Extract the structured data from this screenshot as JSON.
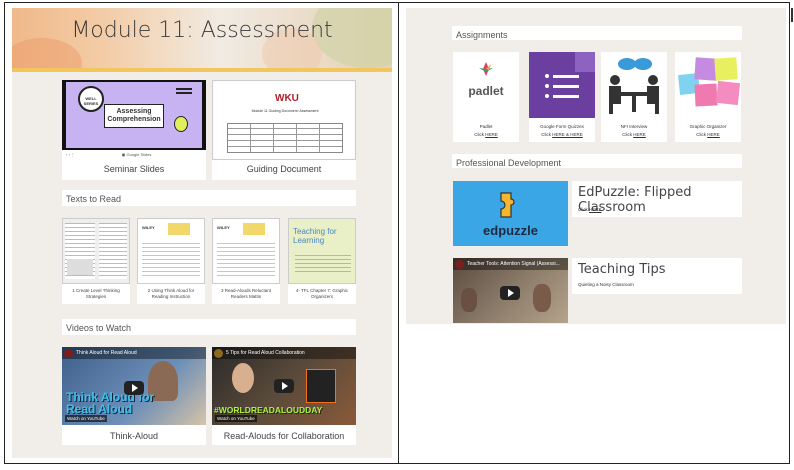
{
  "banner": {
    "title": "Module 11: Assessment"
  },
  "top_cards": [
    {
      "caption": "Seminar Slides",
      "thumb_title": "Assessing Comprehension",
      "badge": "WELL SERIES"
    },
    {
      "caption": "Guiding Document",
      "thumb_title": "Module 11 Guiding Document: Assessment",
      "logo": "WKU"
    }
  ],
  "texts_section": {
    "label": "Texts to Read"
  },
  "texts": [
    {
      "caption": "1 Create Level Thinking Strategies"
    },
    {
      "caption": "2 Using Think Aloud for Reading Instruction"
    },
    {
      "caption": "3 Read-Alouds Reluctant Readers Mattin"
    },
    {
      "caption": "4- TFL Chapter 7: Graphic Organizers",
      "thumb_title": "Teaching for Learning"
    }
  ],
  "videos_section": {
    "label": "Videos to Watch"
  },
  "videos": [
    {
      "caption": "Think-Aloud",
      "video_title": "Think Aloud for Read Aloud",
      "overlay": "Think Aloud for Read Aloud",
      "watch": "Watch on YouTube"
    },
    {
      "caption": "Read-Alouds for Collaboration",
      "video_title": "5 Tips for Read Aloud Collaboration",
      "overlay": "#WORLDREADALOUDDAY",
      "watch": "Watch on YouTube"
    }
  ],
  "assignments_section": {
    "label": "Assignments"
  },
  "assignments": [
    {
      "caption": "Padlet",
      "link_prefix": "Click ",
      "link": "HERE",
      "logo_text": "padlet"
    },
    {
      "caption": "Google Form Quizzes",
      "link_prefix": "Click ",
      "link": "HERE & HERE"
    },
    {
      "caption": "NFI Interview",
      "link_prefix": "Click ",
      "link": "HERE"
    },
    {
      "caption": "Graphic Organizer",
      "link_prefix": "Click ",
      "link": "HERE"
    }
  ],
  "pd_section": {
    "label": "Professional Development"
  },
  "pd_items": [
    {
      "title": "EdPuzzle: Flipped Classroom",
      "sub_prefix": "Click ",
      "sub_link": "HERE",
      "logo_text": "edpuzzle"
    },
    {
      "title": "Teaching Tips",
      "sub": "Quieting a Noisy Classroom",
      "video_title": "Teacher Tools: Attention Signal (Assessi..."
    }
  ],
  "colors": {
    "banner_accent": "#f2c65c",
    "page_bg": "#f1ede9",
    "padlet_pink": "#e23b6a",
    "forms_purple": "#6b3fa0",
    "edpuzzle_blue": "#3aa6e6",
    "edpuzzle_yellow": "#f5b72e"
  },
  "icons": [
    "padlet-icon",
    "google-forms-icon",
    "interview-icon",
    "sticky-notes-icon",
    "edpuzzle-icon",
    "youtube-play-icon"
  ]
}
